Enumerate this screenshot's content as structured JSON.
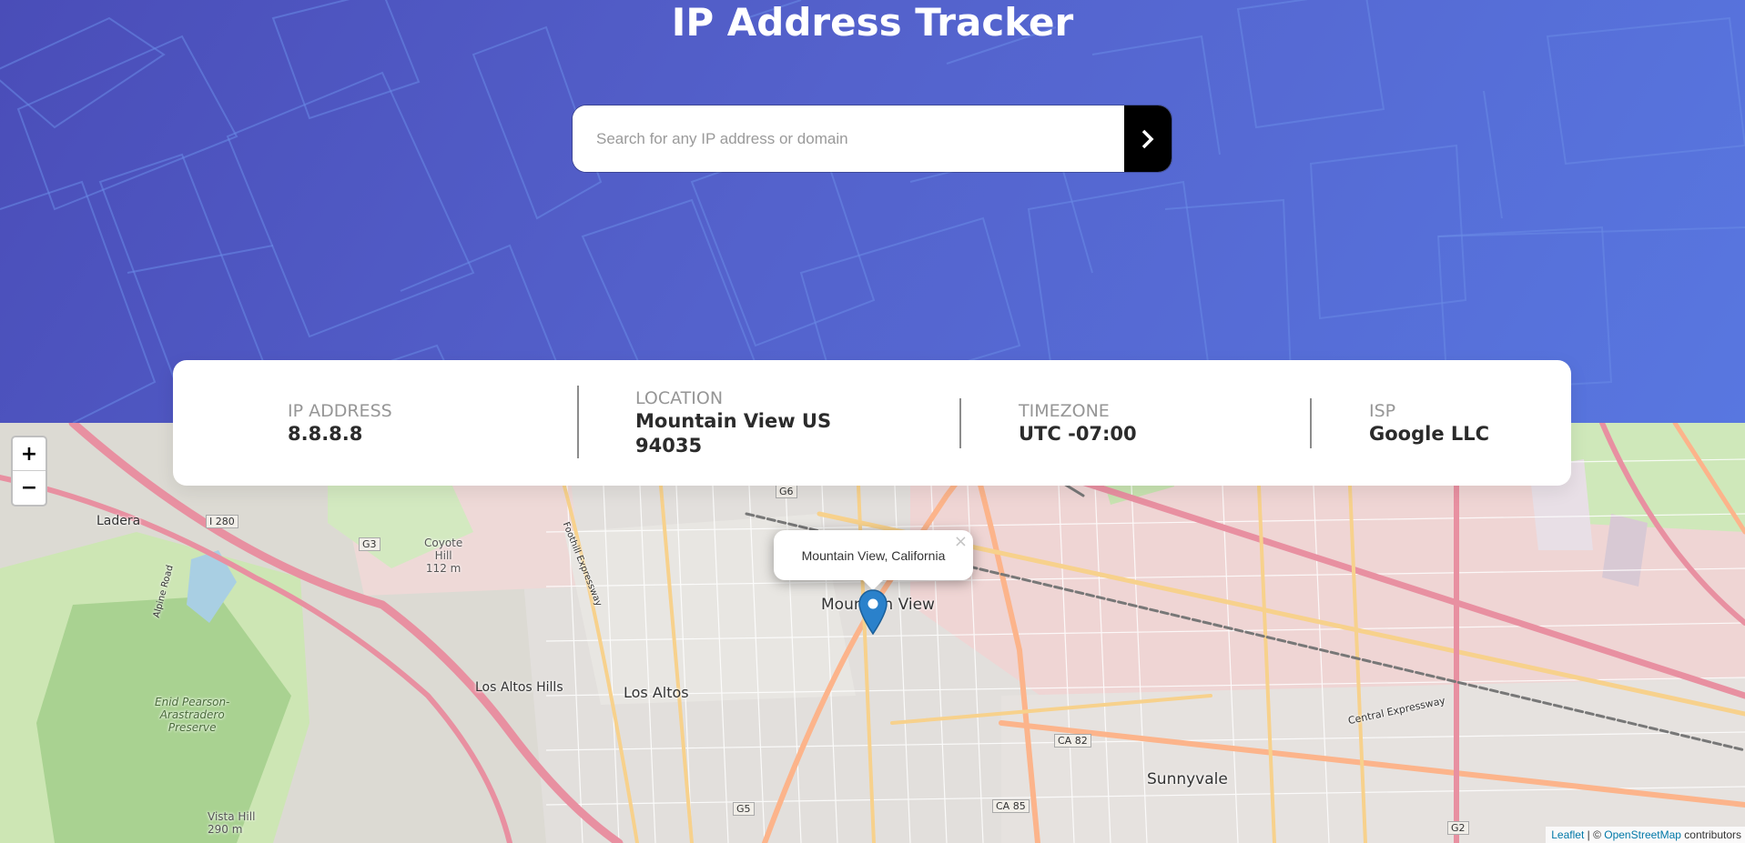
{
  "header": {
    "title": "IP Address Tracker"
  },
  "search": {
    "placeholder": "Search for any IP address or domain",
    "value": "",
    "submit_icon": "chevron-right-icon"
  },
  "info": {
    "ip_label": "IP ADDRESS",
    "ip_value": "8.8.8.8",
    "location_label": "LOCATION",
    "location_line1": "Mountain View US",
    "location_line2": "94035",
    "timezone_label": "TIMEZONE",
    "timezone_value": "UTC -07:00",
    "isp_label": "ISP",
    "isp_value": "Google LLC"
  },
  "map": {
    "zoom_in": "+",
    "zoom_out": "−",
    "popup_text": "Mountain View, California",
    "popup_close": "×",
    "marker_icon": "map-pin-icon",
    "attribution_leaflet": "Leaflet",
    "attribution_sep": " | © ",
    "attribution_osm": "OpenStreetMap",
    "attribution_tail": " contributors",
    "places": {
      "mountain_view": "Mountain View",
      "los_altos": "Los Altos",
      "los_altos_hills": "Los Altos Hills",
      "sunnyvale": "Sunnyvale",
      "ladera": "Ladera",
      "coyote_hill": "Coyote\nHill\n112 m",
      "enid_pearson": "Enid Pearson-\nArastradero\nPreserve",
      "vista_hill": "Vista Hill\n290 m",
      "foothill_expressway": "Foothill Expressway",
      "central_expressway": "Central Expressway",
      "alpine_road": "Alpine Road",
      "i280": "I 280",
      "g3": "G3",
      "g5": "G5",
      "g6": "G6",
      "ca82": "CA 82",
      "ca85": "CA 85",
      "g2": "G2"
    }
  },
  "colors": {
    "hero_start": "#4a4db8",
    "hero_end": "#5877e0",
    "card_bg": "#ffffff",
    "label": "#969696",
    "value": "#2b2b2b",
    "button": "#000000",
    "marker": "#2a81cb",
    "link": "#0078a8"
  }
}
